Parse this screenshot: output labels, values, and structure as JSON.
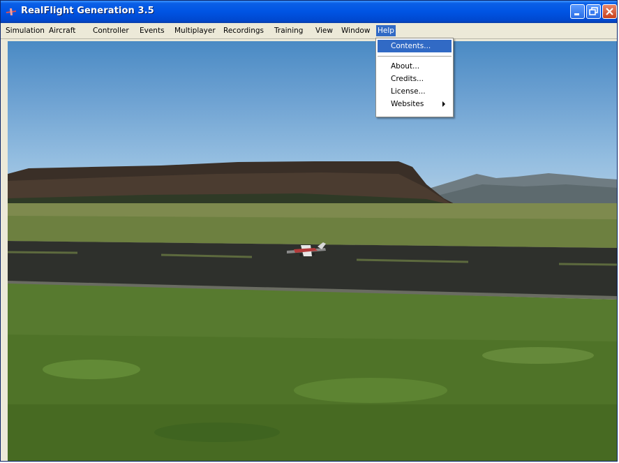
{
  "window": {
    "title": "RealFlight Generation 3.5"
  },
  "menubar": {
    "items": [
      "Simulation",
      "Aircraft",
      "Controller",
      "Events",
      "Multiplayer",
      "Recordings",
      "Training",
      "View",
      "Window",
      "Help"
    ],
    "active": "Help"
  },
  "help_menu": {
    "items": [
      {
        "label": "Contents...",
        "selected": true
      },
      {
        "label": "About..."
      },
      {
        "label": "Credits..."
      },
      {
        "label": "License..."
      },
      {
        "label": "Websites",
        "submenu": true
      }
    ]
  },
  "icons": [
    "app-icon",
    "minimize-icon",
    "maximize-icon",
    "close-icon",
    "submenu-arrow-icon"
  ],
  "colors": {
    "titlebar": "#0054e3",
    "menu_highlight": "#316ac5",
    "menubar": "#ece9d8"
  }
}
